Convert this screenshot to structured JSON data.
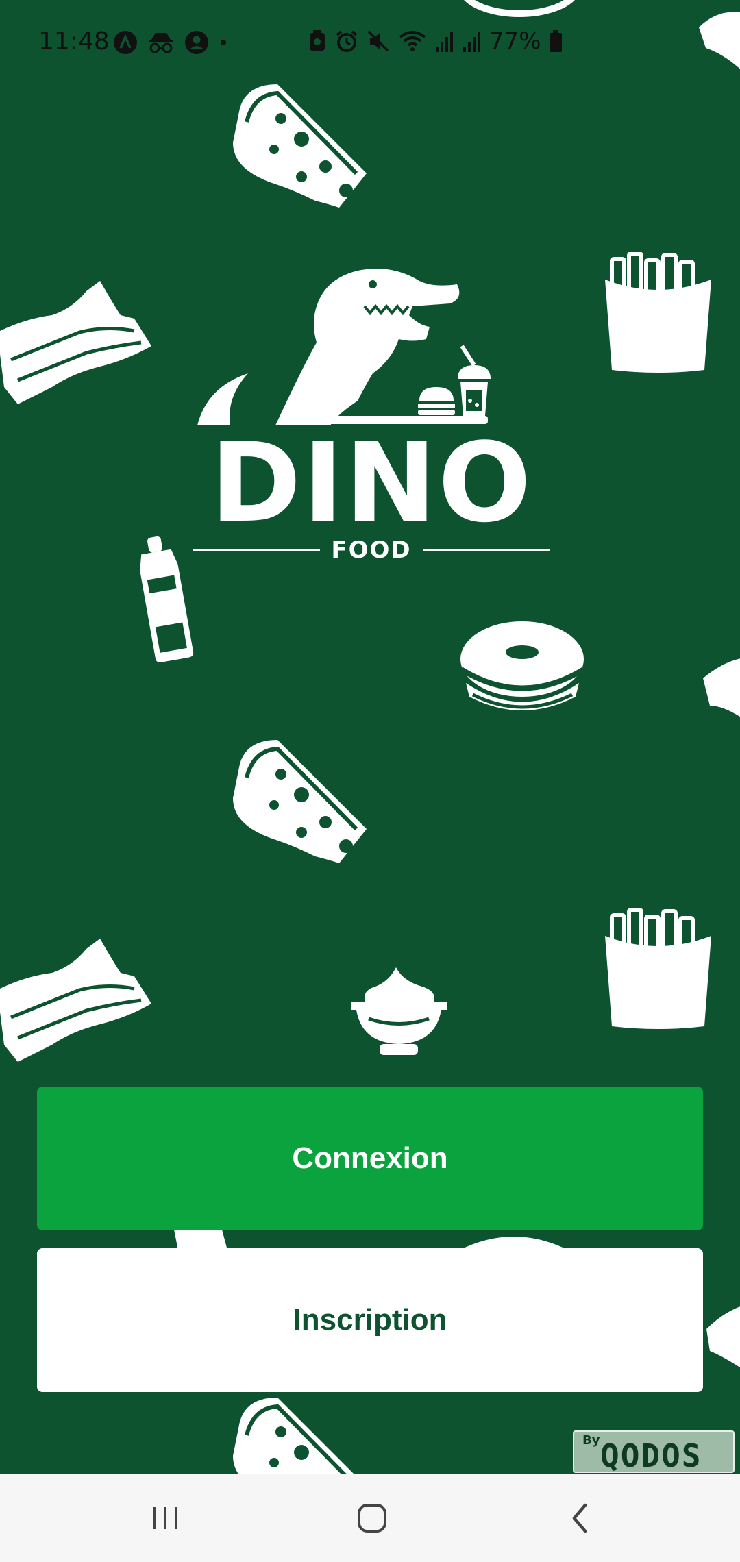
{
  "status_bar": {
    "time": "11:48",
    "battery": "77%"
  },
  "logo": {
    "word": "DINO",
    "subtitle": "FOOD"
  },
  "buttons": {
    "login": "Connexion",
    "signup": "Inscription"
  },
  "badge": {
    "by": "By",
    "name": "QODOS"
  },
  "colors": {
    "background": "#0d5330",
    "primary": "#0aa33d",
    "secondary_bg": "#ffffff",
    "secondary_text": "#0d5330"
  }
}
